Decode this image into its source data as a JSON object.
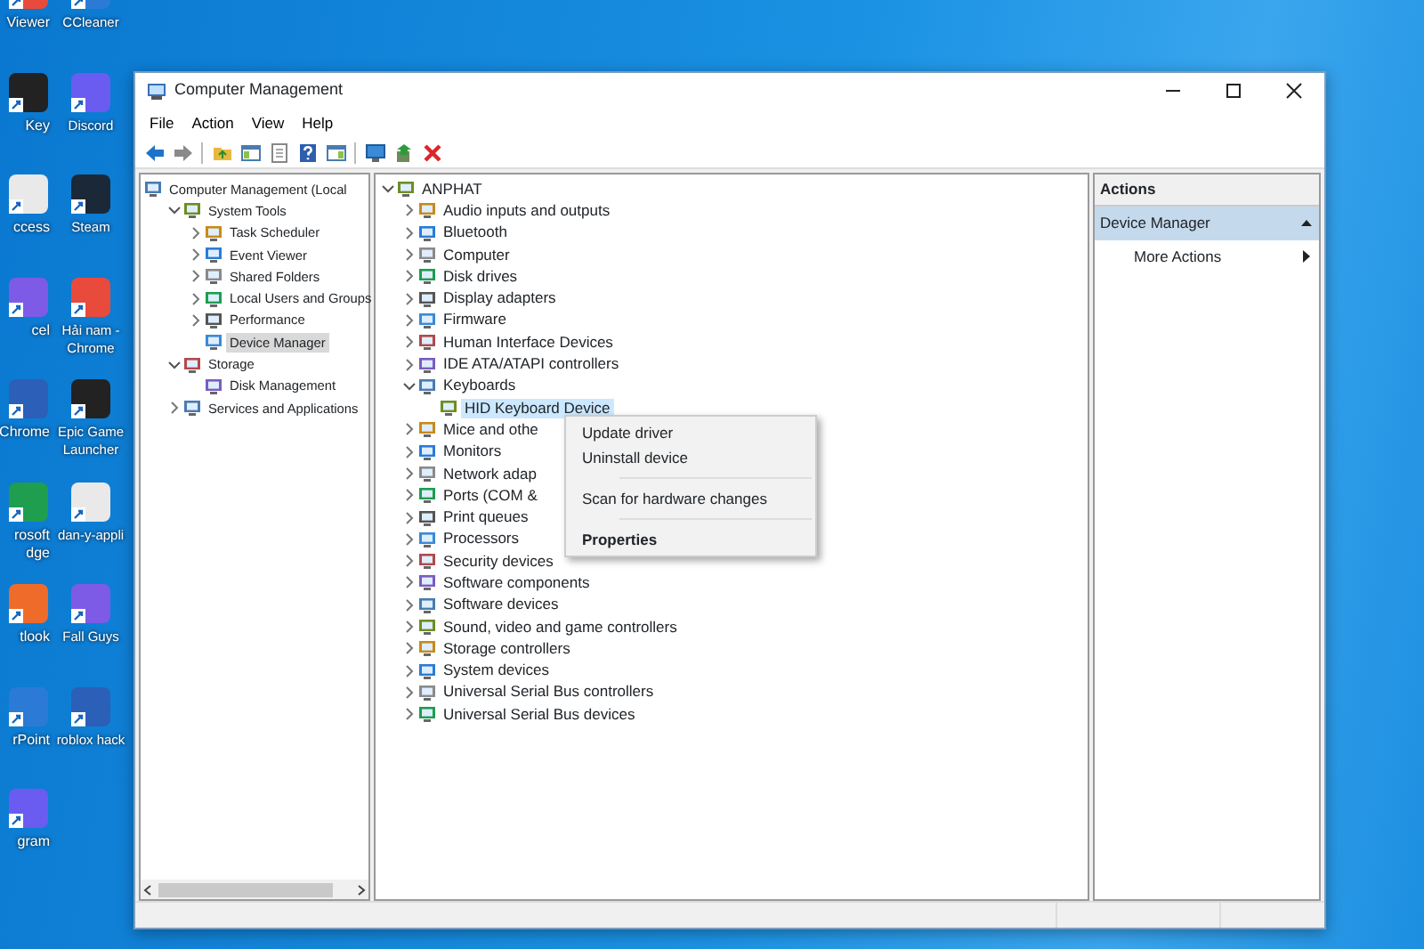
{
  "desktop": {
    "icons_left": [
      {
        "label": "Viewer"
      },
      {
        "label": "Key"
      },
      {
        "label": "ccess"
      },
      {
        "label": "cel"
      },
      {
        "label": "Chrome"
      },
      {
        "label": "rosoft dge"
      },
      {
        "label": "tlook"
      },
      {
        "label": "rPoint"
      },
      {
        "label": "gram"
      }
    ],
    "icons_right": [
      {
        "label": "CCleaner"
      },
      {
        "label": "Discord"
      },
      {
        "label": "Steam"
      },
      {
        "label": "Hải nam - Chrome"
      },
      {
        "label": "Epic Game Launcher"
      },
      {
        "label": "dan-y-appli"
      },
      {
        "label": "Fall Guys"
      },
      {
        "label": "roblox hack"
      }
    ]
  },
  "window": {
    "title": "Computer Management",
    "menu": [
      "File",
      "Action",
      "View",
      "Help"
    ],
    "console_tree": [
      {
        "label": "Computer Management (Local",
        "kind": "root",
        "selected": false,
        "children": [
          {
            "label": "System Tools",
            "kind": "branch",
            "expanded": true,
            "selected": false,
            "children": [
              {
                "label": "Task Scheduler",
                "kind": "branch",
                "expanded": false,
                "selected": false
              },
              {
                "label": "Event Viewer",
                "kind": "branch",
                "expanded": false,
                "selected": false
              },
              {
                "label": "Shared Folders",
                "kind": "branch",
                "expanded": false,
                "selected": false
              },
              {
                "label": "Local Users and Groups",
                "kind": "branch",
                "expanded": false,
                "selected": false
              },
              {
                "label": "Performance",
                "kind": "branch",
                "expanded": false,
                "selected": false
              },
              {
                "label": "Device Manager",
                "kind": "leaf",
                "selected": true
              }
            ]
          },
          {
            "label": "Storage",
            "kind": "branch",
            "expanded": true,
            "selected": false,
            "children": [
              {
                "label": "Disk Management",
                "kind": "leaf",
                "selected": false
              }
            ]
          },
          {
            "label": "Services and Applications",
            "kind": "branch",
            "expanded": false,
            "selected": false
          }
        ]
      }
    ],
    "device_tree": [
      {
        "label": "ANPHAT",
        "kind": "branch",
        "expanded": true,
        "selected": false,
        "children": [
          {
            "label": "Audio inputs and outputs",
            "kind": "branch",
            "expanded": false,
            "selected": false
          },
          {
            "label": "Bluetooth",
            "kind": "branch",
            "expanded": false,
            "selected": false
          },
          {
            "label": "Computer",
            "kind": "branch",
            "expanded": false,
            "selected": false
          },
          {
            "label": "Disk drives",
            "kind": "branch",
            "expanded": false,
            "selected": false
          },
          {
            "label": "Display adapters",
            "kind": "branch",
            "expanded": false,
            "selected": false
          },
          {
            "label": "Firmware",
            "kind": "branch",
            "expanded": false,
            "selected": false
          },
          {
            "label": "Human Interface Devices",
            "kind": "branch",
            "expanded": false,
            "selected": false
          },
          {
            "label": "IDE ATA/ATAPI controllers",
            "kind": "branch",
            "expanded": false,
            "selected": false
          },
          {
            "label": "Keyboards",
            "kind": "branch",
            "expanded": true,
            "selected": false,
            "children": [
              {
                "label": "HID Keyboard Device",
                "kind": "leaf",
                "selected": true
              }
            ]
          },
          {
            "label": "Mice and othe",
            "kind": "branch",
            "expanded": false,
            "selected": false
          },
          {
            "label": "Monitors",
            "kind": "branch",
            "expanded": false,
            "selected": false
          },
          {
            "label": "Network adap",
            "kind": "branch",
            "expanded": false,
            "selected": false
          },
          {
            "label": "Ports (COM &",
            "kind": "branch",
            "expanded": false,
            "selected": false
          },
          {
            "label": "Print queues",
            "kind": "branch",
            "expanded": false,
            "selected": false
          },
          {
            "label": "Processors",
            "kind": "branch",
            "expanded": false,
            "selected": false
          },
          {
            "label": "Security devices",
            "kind": "branch",
            "expanded": false,
            "selected": false
          },
          {
            "label": "Software components",
            "kind": "branch",
            "expanded": false,
            "selected": false
          },
          {
            "label": "Software devices",
            "kind": "branch",
            "expanded": false,
            "selected": false
          },
          {
            "label": "Sound, video and game controllers",
            "kind": "branch",
            "expanded": false,
            "selected": false
          },
          {
            "label": "Storage controllers",
            "kind": "branch",
            "expanded": false,
            "selected": false
          },
          {
            "label": "System devices",
            "kind": "branch",
            "expanded": false,
            "selected": false
          },
          {
            "label": "Universal Serial Bus controllers",
            "kind": "branch",
            "expanded": false,
            "selected": false
          },
          {
            "label": "Universal Serial Bus devices",
            "kind": "branch",
            "expanded": false,
            "selected": false
          }
        ]
      }
    ],
    "context_menu": [
      {
        "label": "Update driver",
        "kind": "item"
      },
      {
        "label": "Uninstall device",
        "kind": "item"
      },
      {
        "kind": "separator"
      },
      {
        "label": "Scan for hardware changes",
        "kind": "item"
      },
      {
        "kind": "separator"
      },
      {
        "label": "Properties",
        "kind": "default"
      }
    ],
    "actions": {
      "header": "Actions",
      "section": {
        "label": "Device Manager",
        "expanded": true
      },
      "items": [
        {
          "label": "More Actions"
        }
      ]
    }
  }
}
